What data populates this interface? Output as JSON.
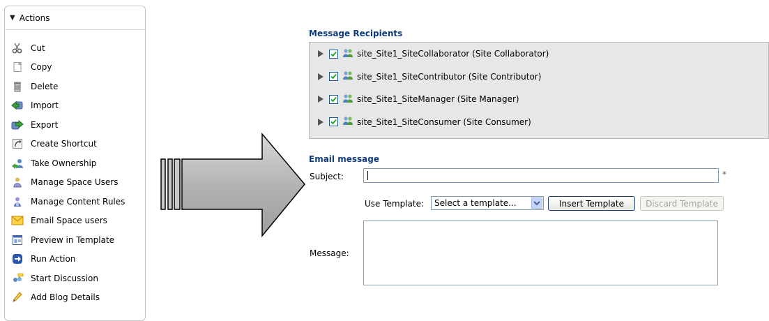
{
  "actions": {
    "header": "Actions",
    "items": [
      {
        "label": "Cut",
        "icon": "scissors-icon"
      },
      {
        "label": "Copy",
        "icon": "copy-icon"
      },
      {
        "label": "Delete",
        "icon": "trash-icon"
      },
      {
        "label": "Import",
        "icon": "import-icon"
      },
      {
        "label": "Export",
        "icon": "export-icon"
      },
      {
        "label": "Create Shortcut",
        "icon": "shortcut-icon"
      },
      {
        "label": "Take Ownership",
        "icon": "take-ownership-icon"
      },
      {
        "label": "Manage Space Users",
        "icon": "users-icon"
      },
      {
        "label": "Manage Content Rules",
        "icon": "rules-icon"
      },
      {
        "label": "Email Space users",
        "icon": "email-icon"
      },
      {
        "label": "Preview in Template",
        "icon": "template-icon"
      },
      {
        "label": "Run Action",
        "icon": "run-action-icon"
      },
      {
        "label": "Start Discussion",
        "icon": "discussion-icon"
      },
      {
        "label": "Add Blog Details",
        "icon": "pencil-icon"
      }
    ]
  },
  "recipients": {
    "title": "Message Recipients",
    "items": [
      {
        "label": "site_Site1_SiteCollaborator (Site Collaborator)",
        "checked": true
      },
      {
        "label": "site_Site1_SiteContributor (Site Contributor)",
        "checked": true
      },
      {
        "label": "site_Site1_SiteManager (Site Manager)",
        "checked": true
      },
      {
        "label": "site_Site1_SiteConsumer (Site Consumer)",
        "checked": true
      }
    ]
  },
  "email": {
    "title": "Email message",
    "subject_label": "Subject:",
    "subject_value": "",
    "required_marker": "*",
    "template_label": "Use Template:",
    "template_selected": "Select a template...",
    "insert_button": "Insert Template",
    "discard_button": "Discard Template",
    "message_label": "Message:",
    "message_value": ""
  },
  "colors": {
    "section_title": "#0f3b7f",
    "recipients_bg": "#e7e7e7",
    "input_border": "#7f9db9"
  }
}
